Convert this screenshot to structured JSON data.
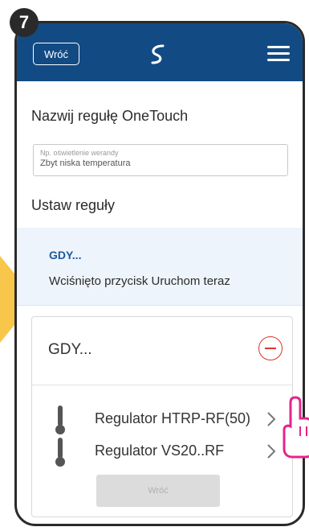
{
  "step": "7",
  "header": {
    "back_label": "Wróć",
    "logo": "salus-logo-icon",
    "menu_icon": "hamburger-menu-icon"
  },
  "rule_name": {
    "title": "Nazwij regułę OneTouch",
    "placeholder": "Np. oświetlenie werandy",
    "value": "Zbyt niska temperatura"
  },
  "set_rules": {
    "title": "Ustaw reguły"
  },
  "trigger": {
    "label": "GDY...",
    "description": "Wciśnięto przycisk Uruchom teraz"
  },
  "condition": {
    "label": "GDY...",
    "remove_icon": "minus-circle-icon",
    "devices": [
      {
        "name": "Regulator HTRP-RF(50)",
        "icon": "thermometer-icon"
      },
      {
        "name": "Regulator VS20..RF",
        "icon": "thermometer-icon"
      }
    ],
    "back_button": "Wróć"
  },
  "colors": {
    "header_bg": "#124b84",
    "accent_blue": "#1a5aa0",
    "remove_red": "#d8362f",
    "highlight_yellow": "#f7c64a",
    "hand_pink": "#e6248a"
  }
}
